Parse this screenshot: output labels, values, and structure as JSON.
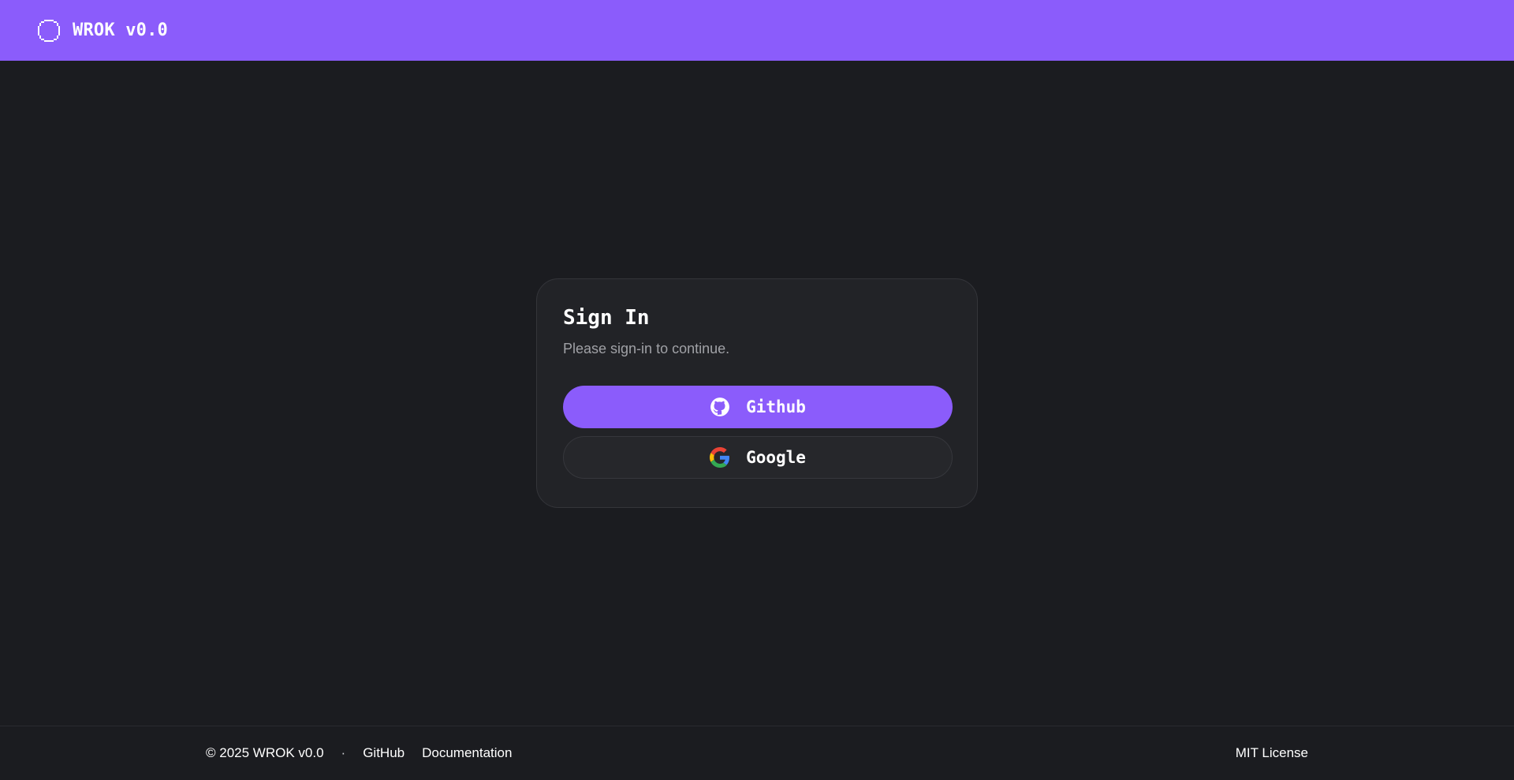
{
  "header": {
    "logo_icon": "pixel-circle-icon",
    "brand": "WROK v0.0"
  },
  "signin": {
    "title": "Sign In",
    "subtitle": "Please sign-in to continue.",
    "buttons": [
      {
        "label": "Github",
        "icon": "github-icon"
      },
      {
        "label": "Google",
        "icon": "google-icon"
      }
    ]
  },
  "footer": {
    "copyright": "© 2025 WROK v0.0",
    "separator": "·",
    "links": [
      "GitHub",
      "Documentation"
    ],
    "license": "MIT License"
  },
  "colors": {
    "accent": "#8b5cfb",
    "background": "#1b1c20",
    "card": "#222327",
    "muted_text": "#a0a1a6"
  }
}
